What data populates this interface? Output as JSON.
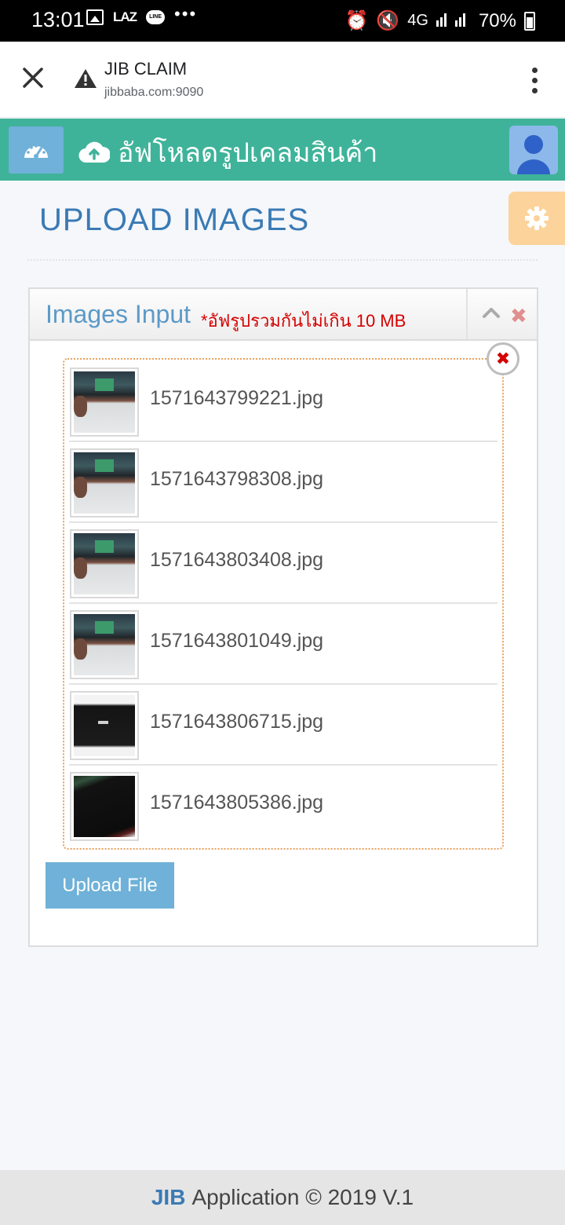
{
  "status_bar": {
    "time": "13:01",
    "laz_label": "LAZ",
    "line_label": "LINE",
    "more_indicator": "•••",
    "network": "4G",
    "battery": "70%"
  },
  "browser": {
    "site_title": "JIB CLAIM",
    "url": "jibbaba.com:9090"
  },
  "app_header": {
    "title": "อัฟโหลดรูปเคลมสินค้า"
  },
  "page": {
    "title": "UPLOAD IMAGES"
  },
  "widget": {
    "title": "Images Input",
    "note": "*อัฟรูปรวมกันไม่เกิน 10 MB",
    "close_symbol": "✖",
    "remove_all_symbol": "✖"
  },
  "files": [
    {
      "name": "1571643799221.jpg",
      "thumb": "photo-a"
    },
    {
      "name": "1571643798308.jpg",
      "thumb": "photo-a"
    },
    {
      "name": "1571643803408.jpg",
      "thumb": "photo-a"
    },
    {
      "name": "1571643801049.jpg",
      "thumb": "photo-a"
    },
    {
      "name": "1571643806715.jpg",
      "thumb": "photo-b"
    },
    {
      "name": "1571643805386.jpg",
      "thumb": "photo-c"
    }
  ],
  "actions": {
    "upload_label": "Upload File"
  },
  "footer": {
    "brand": "JIB",
    "text": "Application © 2019 V.1"
  },
  "colors": {
    "header_green": "#3fb39a",
    "accent_blue": "#6fb1d8",
    "title_blue": "#3a7ab4",
    "note_red": "#d50000",
    "settings_orange": "#fcd39b"
  }
}
